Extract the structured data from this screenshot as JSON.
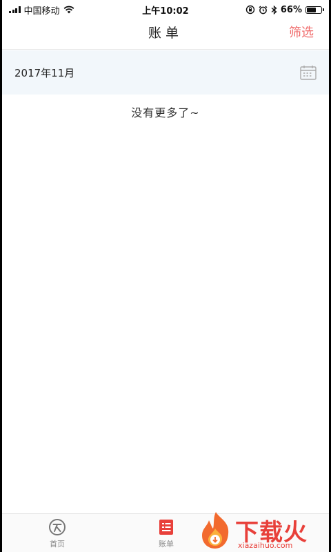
{
  "status_bar": {
    "carrier": "中国移动",
    "time": "上午10:02",
    "battery_percent": "66%",
    "battery_level": 0.66
  },
  "nav": {
    "title": "账单",
    "filter_label": "筛选"
  },
  "month_header": {
    "month": "2017年11月"
  },
  "list": {
    "empty_text": "没有更多了~"
  },
  "tabbar": {
    "items": [
      {
        "label": "首页",
        "icon": "home-icon"
      },
      {
        "label": "账单",
        "icon": "bill-icon"
      }
    ]
  },
  "watermark": {
    "text": "下载火",
    "url": "xiazaihuo.com"
  },
  "colors": {
    "accent": "#f06b6b",
    "bill_tab_active": "#e8403a",
    "month_header_bg": "#f2f7fb"
  }
}
